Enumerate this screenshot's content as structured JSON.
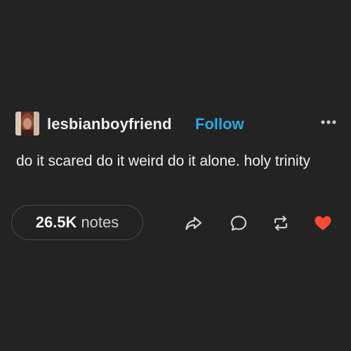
{
  "post": {
    "username": "lesbianboyfriend",
    "follow_label": "Follow",
    "body": "do it scared do it weird do it alone. holy trinity",
    "notes_count": "26.5K",
    "notes_label": "notes"
  },
  "icons": {
    "more": "more-dots-icon",
    "share": "share-arrow-icon",
    "reply": "reply-bubble-icon",
    "reblog": "reblog-icon",
    "like": "heart-icon"
  },
  "colors": {
    "background": "#232323",
    "follow": "#2aa7e6",
    "like": "#ff4930",
    "icon": "#d0d0d0"
  }
}
